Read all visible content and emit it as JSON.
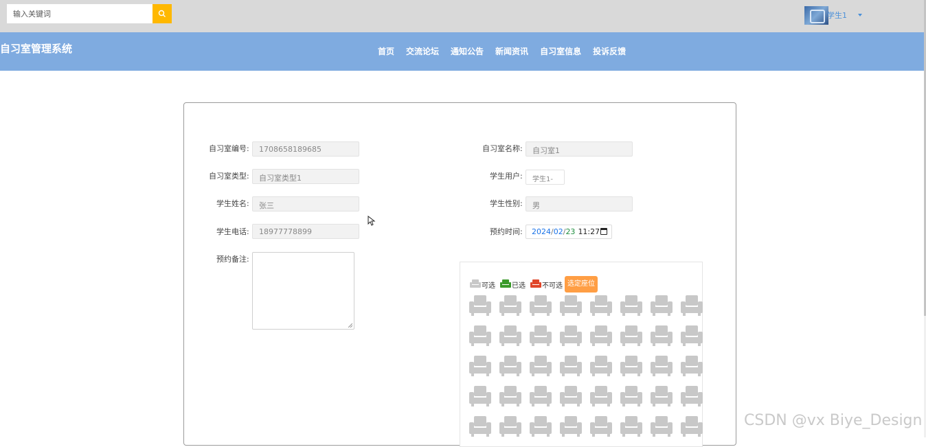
{
  "search": {
    "placeholder": "输入关键词"
  },
  "user": {
    "name": "学生1"
  },
  "brand": "自习室管理系统",
  "nav": [
    "首页",
    "交流论坛",
    "通知公告",
    "新闻资讯",
    "自习室信息",
    "投诉反馈"
  ],
  "form": {
    "room_no": {
      "label": "自习室编号:",
      "value": "1708658189685"
    },
    "room_name": {
      "label": "自习室名称:",
      "value": "自习室1"
    },
    "room_type": {
      "label": "自习室类型:",
      "value": "自习室类型1"
    },
    "student_user": {
      "label": "学生用户:",
      "value": "学生1-"
    },
    "student_name": {
      "label": "学生姓名:",
      "value": "张三"
    },
    "student_gender": {
      "label": "学生性别:",
      "value": "男"
    },
    "student_phone": {
      "label": "学生电话:",
      "value": "18977778899"
    },
    "reserve_time": {
      "label": "预约时间:",
      "year": "2024",
      "month": "02",
      "day": "23",
      "time": "11:27"
    },
    "remark": {
      "label": "预约备注:",
      "value": ""
    }
  },
  "seats": {
    "legend": {
      "available": "可选",
      "taken": "已选",
      "unavailable": "不可选"
    },
    "pick_label": "选定座位",
    "colors": {
      "available": "#c8c8c8",
      "taken": "#3a9a2a",
      "unavailable": "#e0462a",
      "pick_button": "#ff9e44"
    },
    "rows": 5,
    "cols": 8
  },
  "watermark": "CSDN @vx Biye_Design"
}
